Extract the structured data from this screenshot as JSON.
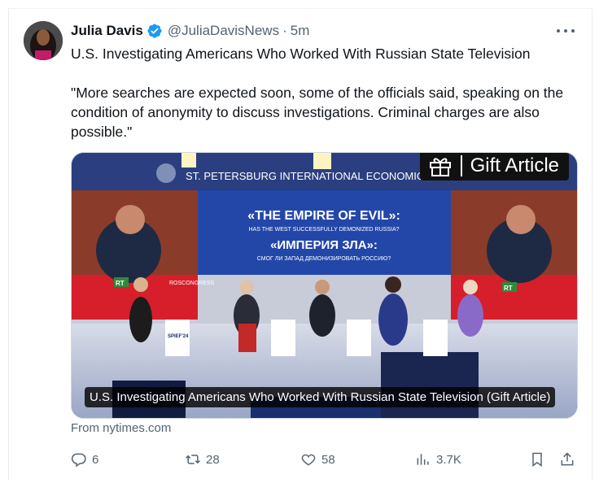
{
  "author": {
    "name": "Julia Davis",
    "handle": "@JuliaDavisNews",
    "separator": "·",
    "time": "5m",
    "verified_color": "#1d9bf0"
  },
  "tweet": {
    "headline": "U.S. Investigating Americans Who Worked With Russian State Television",
    "quote": "\"More searches are expected soon, some of the officials said, speaking on the condition of anonymity to discuss investigations. Criminal charges are also possible.\""
  },
  "card": {
    "gift_label": "Gift Article",
    "caption": "U.S. Investigating Americans Who Worked With Russian State Television (Gift Article)",
    "source": "From nytimes.com",
    "banner": {
      "top_text": "ST. PETERSBURG INTERNATIONAL ECONOMIC FORUM",
      "title_en": "«THE EMPIRE OF EVIL»:",
      "subtitle_en": "HAS THE WEST SUCCESSFULLY DEMONIZED RUSSIA?",
      "title_ru": "«ИМПЕРИЯ ЗЛА»:",
      "subtitle_ru": "СМОГ ЛИ ЗАПАД ДЕМОНИЗИРОВАТЬ РОССИЮ?",
      "rt_label": "RT",
      "roscongress_label": "ROSCONGRESS",
      "spief_label": "SPIEF'24"
    }
  },
  "actions": {
    "replies": "6",
    "reposts": "28",
    "likes": "58",
    "views": "3.7K"
  },
  "icons": {
    "reply": "reply-icon",
    "repost": "repost-icon",
    "like": "heart-icon",
    "views": "bar-chart-icon",
    "bookmark": "bookmark-icon",
    "share": "share-icon",
    "more": "more-icon",
    "gift": "gift-icon"
  }
}
